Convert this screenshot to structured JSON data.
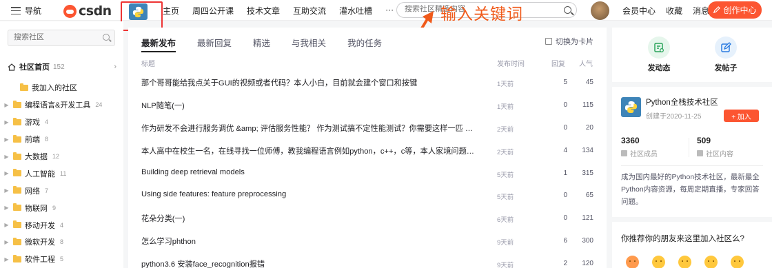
{
  "header": {
    "nav_label": "导航",
    "logo_text": "csdn",
    "links": [
      "主页",
      "周四公开课",
      "技术文章",
      "互助交流",
      "灌水吐槽",
      "···"
    ],
    "search_placeholder": "搜索社区精选内容",
    "annotation": "输入关键词",
    "user_links": [
      "会员中心",
      "收藏",
      "消息"
    ],
    "create_label": "创作中心",
    "accent_color": "#fc5531",
    "annotation_color": "#f05a1a"
  },
  "sidebar": {
    "search_placeholder": "搜索社区",
    "home_label": "社区首页",
    "home_count": "152",
    "items": [
      {
        "label": "我加入的社区",
        "count": ""
      },
      {
        "label": "编程语言&开发工具",
        "count": "24"
      },
      {
        "label": "游戏",
        "count": "4"
      },
      {
        "label": "前端",
        "count": "8"
      },
      {
        "label": "大数据",
        "count": "12"
      },
      {
        "label": "人工智能",
        "count": "11"
      },
      {
        "label": "网络",
        "count": "7"
      },
      {
        "label": "物联网",
        "count": "9"
      },
      {
        "label": "移动开发",
        "count": "4"
      },
      {
        "label": "微软开发",
        "count": "8"
      },
      {
        "label": "软件工程",
        "count": "5"
      }
    ]
  },
  "main": {
    "tabs": [
      "最新发布",
      "最新回复",
      "精选",
      "与我相关",
      "我的任务"
    ],
    "switch_label": "切换为卡片",
    "columns": {
      "title": "标题",
      "date": "发布时间",
      "replies": "回复",
      "views": "人气"
    },
    "posts": [
      {
        "title": "那个哥哥能给我点关于GUI的视频或者代码？本人小白，目前就会建个窗口和按键",
        "date": "1天前",
        "replies": "5",
        "views": "45"
      },
      {
        "title": "NLP随笔(一)",
        "date": "1天前",
        "replies": "0",
        "views": "115"
      },
      {
        "title": "作为研发不会进行服务调优 &amp; 评估服务性能？ 作为测试搞不定性能测试？你需要这样一匹 …",
        "date": "2天前",
        "replies": "0",
        "views": "20"
      },
      {
        "title": "本人高中在校生一名，在线寻找一位师傅，教我编程语言例如python，c++，c等，本人家境问题…",
        "date": "2天前",
        "replies": "4",
        "views": "134"
      },
      {
        "title": "Building deep retrieval models",
        "date": "5天前",
        "replies": "1",
        "views": "315"
      },
      {
        "title": "Using side features: feature preprocessing",
        "date": "5天前",
        "replies": "0",
        "views": "65"
      },
      {
        "title": "花朵分类(一)",
        "date": "6天前",
        "replies": "0",
        "views": "121"
      },
      {
        "title": "怎么学习phthon",
        "date": "9天前",
        "replies": "6",
        "views": "300"
      },
      {
        "title": "python3.6 安装face_recognition报错",
        "date": "9天前",
        "replies": "2",
        "views": "120"
      }
    ]
  },
  "right": {
    "actions": [
      {
        "label": "发动态",
        "icon": "post-dynamic-icon"
      },
      {
        "label": "发帖子",
        "icon": "edit-post-icon"
      }
    ],
    "community": {
      "name": "Python全栈技术社区",
      "created": "创建于2020-11-25",
      "join_label": "+ 加入",
      "members": "3360",
      "members_label": "社区成员",
      "content_count": "509",
      "content_label": "社区内容",
      "description": "成为国内最好的Python技术社区，最新最全Python内容资源，每周定期直播，专家回答问题。"
    },
    "recommend_question": "你推荐你的朋友来这里加入社区么?"
  }
}
